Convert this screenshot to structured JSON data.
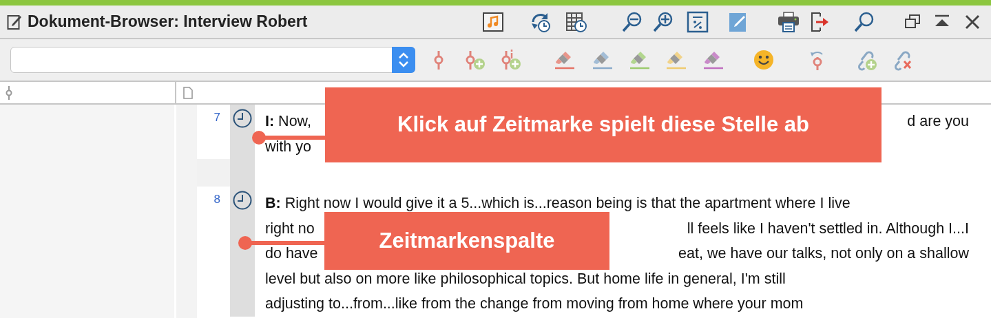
{
  "window": {
    "title": "Dokument-Browser: Interview Robert"
  },
  "paragraphs": [
    {
      "number": "7",
      "lines": [
        {
          "left": "**I:** Now,",
          "right": "d are you"
        },
        {
          "left": "with yo"
        }
      ]
    },
    {
      "number": "8",
      "lines": [
        {
          "left": "**B:** Right now I would give it a 5...which is...reason being is that the apartment where I live"
        },
        {
          "left": "right no",
          "right": "ll feels like I haven't settled in. Although I...I"
        },
        {
          "left": "do have",
          "right": "eat, we have our talks, not only on a shallow"
        },
        {
          "left": "level but also on more like philosophical topics. But home life in general, I'm still"
        },
        {
          "left": "adjusting to...from...like from the change from moving from home where your mom"
        }
      ]
    }
  ],
  "callouts": [
    {
      "text": "Klick auf Zeitmarke spielt diese Stelle ab"
    },
    {
      "text": "Zeitmarkenspalte"
    }
  ]
}
